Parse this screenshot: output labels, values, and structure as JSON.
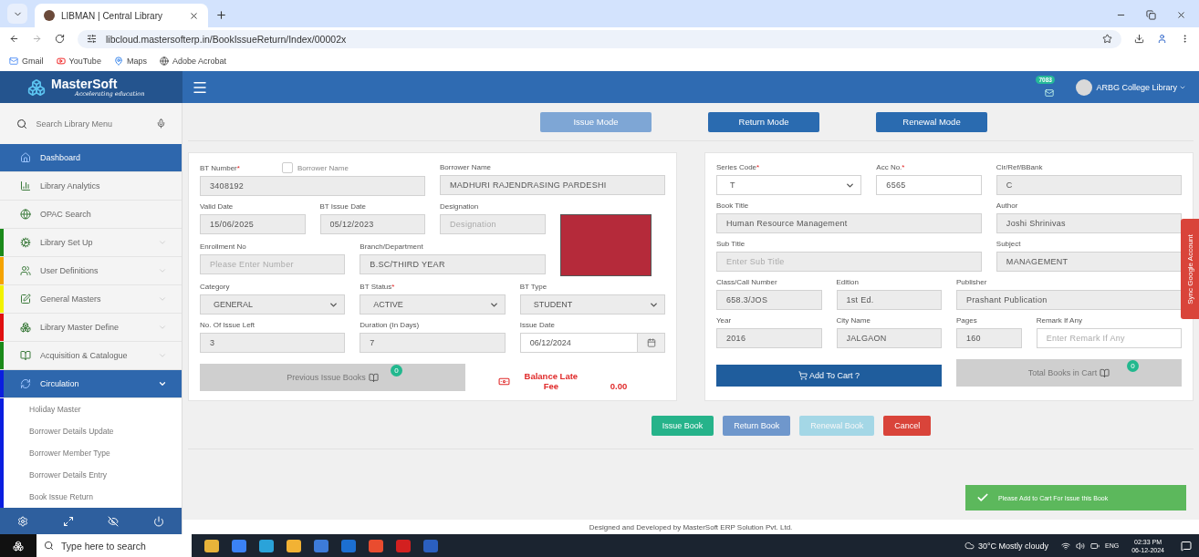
{
  "browser": {
    "tab_title": "LIBMAN | Central Library",
    "url": "libcloud.mastersofterp.in/BookIssueReturn/Index/00002x",
    "bookmarks": [
      "Gmail",
      "YouTube",
      "Maps",
      "Adobe Acrobat"
    ]
  },
  "header": {
    "logo": {
      "name": "MasterSoft",
      "tagline": "Accelerating education"
    },
    "notification_count": "7083",
    "user": "ARBG College Library"
  },
  "sidebar": {
    "search_placeholder": "Search Library Menu",
    "items": [
      {
        "label": "Dashboard",
        "kind": "link",
        "selected": true
      },
      {
        "label": "Library Analytics",
        "kind": "link",
        "selected": false
      },
      {
        "label": "OPAC Search",
        "kind": "link",
        "selected": false
      },
      {
        "label": "Library Set Up",
        "kind": "group",
        "selected": false,
        "expanded": false,
        "color": "#1a8a1a"
      },
      {
        "label": "User Definitions",
        "kind": "group",
        "selected": false,
        "expanded": false,
        "color": "#f5a300"
      },
      {
        "label": "General Masters",
        "kind": "group",
        "selected": false,
        "expanded": false,
        "color": "#f2f200"
      },
      {
        "label": "Library Master Define",
        "kind": "group",
        "selected": false,
        "expanded": false,
        "color": "#e01010"
      },
      {
        "label": "Acquisition & Catalogue",
        "kind": "group",
        "selected": false,
        "expanded": false,
        "color": "#1a8a1a"
      },
      {
        "label": "Circulation",
        "kind": "group",
        "selected": true,
        "expanded": true,
        "color": "#0a1ee0",
        "children": [
          "Holiday Master",
          "Borrower Details Update",
          "Borrower Member Type",
          "Borrower Details Entry",
          "Book Issue Return"
        ]
      }
    ]
  },
  "modes": [
    {
      "label": "Issue Mode",
      "selected": true
    },
    {
      "label": "Return Mode",
      "selected": false
    },
    {
      "label": "Renewal Mode",
      "selected": false
    }
  ],
  "borrower": {
    "rows": [
      [
        {
          "kind": "text",
          "label": "BT Number",
          "mark": "*",
          "value": "3408192",
          "readonly": true,
          "checkbox": {
            "label": "Borrower Name",
            "checked": false
          }
        },
        {
          "kind": "text",
          "label": "Borrower Name",
          "value": "MADHURI RAJENDRASING PARDESHI",
          "readonly": true
        }
      ],
      [
        {
          "kind": "text",
          "label": "Valid Date",
          "value": "15/06/2025",
          "readonly": true
        },
        {
          "kind": "text",
          "label": "BT Issue Date",
          "value": "05/12/2023",
          "readonly": true
        },
        {
          "kind": "text",
          "label": "Designation",
          "placeholder": "Designation",
          "readonly": true
        },
        {
          "kind": "photo"
        }
      ],
      [
        {
          "kind": "text",
          "label": "Enrollment No",
          "placeholder": "Please Enter Number",
          "readonly": true
        },
        {
          "kind": "text",
          "label": "Branch/Department",
          "value": "B.SC/THIRD YEAR",
          "readonly": true
        }
      ],
      [
        {
          "kind": "select",
          "label": "Category",
          "value": "GENERAL",
          "readonly": true
        },
        {
          "kind": "select",
          "label": "BT Status",
          "mark": "*",
          "value": "ACTIVE",
          "readonly": true
        },
        {
          "kind": "select",
          "label": "BT Type",
          "value": "STUDENT",
          "readonly": true
        }
      ],
      [
        {
          "kind": "text",
          "label": "No. Of Issue Left",
          "value": "3",
          "readonly": true
        },
        {
          "kind": "text",
          "label": "Duration (In Days)",
          "value": "7",
          "readonly": true
        },
        {
          "kind": "date",
          "label": "Issue Date",
          "value": "06/12/2024",
          "readonly": false
        }
      ],
      [
        {
          "kind": "button",
          "label": "Previous Issue Books",
          "badge": "0"
        },
        {
          "kind": "fee",
          "label": "Balance Late Fee",
          "value": "0.00"
        }
      ]
    ]
  },
  "book": {
    "rows": [
      [
        {
          "kind": "select",
          "label": "Series Code",
          "mark": "*",
          "value": "T",
          "readonly": false
        },
        {
          "kind": "text",
          "label": "Acc No.",
          "mark": "*",
          "value": "6565",
          "readonly": false
        },
        {
          "kind": "text",
          "label": "Cir/Ref/BBank",
          "value": "C",
          "readonly": true
        }
      ],
      [
        {
          "kind": "text",
          "label": "Book Title",
          "value": "Human Resource Management",
          "readonly": true
        },
        {
          "kind": "text",
          "label": "Author",
          "value": "Joshi Shrinivas",
          "readonly": true
        }
      ],
      [
        {
          "kind": "text",
          "label": "Sub Title",
          "placeholder": "Enter Sub Title",
          "readonly": true
        },
        {
          "kind": "text",
          "label": "Subject",
          "value": "MANAGEMENT",
          "readonly": true
        }
      ],
      [
        {
          "kind": "text",
          "label": "Class/Call Number",
          "value": "658.3/JOS",
          "readonly": true
        },
        {
          "kind": "text",
          "label": "Edition",
          "value": "1st Ed.",
          "readonly": true
        },
        {
          "kind": "text",
          "label": "Publisher",
          "value": "Prashant Publication",
          "readonly": true
        }
      ],
      [
        {
          "kind": "text",
          "label": "Year",
          "value": "2016",
          "readonly": true
        },
        {
          "kind": "text",
          "label": "City Name",
          "value": "JALGAON",
          "readonly": true
        },
        {
          "kind": "text",
          "label": "Pages",
          "value": "160",
          "readonly": true
        },
        {
          "kind": "text",
          "label": "Remark If Any",
          "placeholder": "Enter Remark If Any",
          "readonly": false
        }
      ],
      [
        {
          "kind": "cart",
          "label": "Add To Cart ?"
        },
        {
          "kind": "button",
          "label": "Total Books in Cart",
          "badge": "0"
        }
      ]
    ]
  },
  "actions": [
    {
      "label": "Issue Book",
      "kind": "success",
      "disabled": false
    },
    {
      "label": "Return Book",
      "kind": "primary",
      "disabled": false
    },
    {
      "label": "Renewal Book",
      "kind": "info",
      "disabled": true
    },
    {
      "label": "Cancel",
      "kind": "danger",
      "disabled": false
    }
  ],
  "sync_tab": "Sync Google Account",
  "toast": "Please Add to Cart For Issue this Book",
  "footer": "Designed and Developed by MasterSoft ERP Solution Pvt. Ltd.",
  "taskbar": {
    "search_placeholder": "Type here to search",
    "weather": "30°C  Mostly cloudy",
    "language": "ENG",
    "time": "02:33 PM",
    "date": "06-12-2024"
  }
}
